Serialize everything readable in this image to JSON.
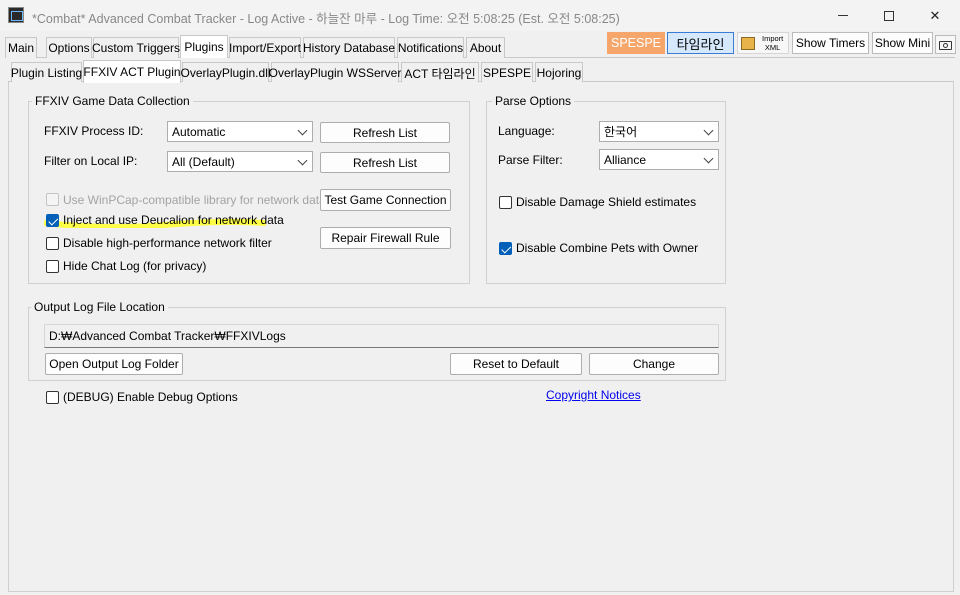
{
  "window": {
    "title": "*Combat* Advanced Combat Tracker - Log Active - 하늘잔 마루 - Log Time: 오전 5:08:25 (Est. 오전 5:08:25)",
    "minimize": "—",
    "maximize": "□",
    "close": "✕"
  },
  "main_tabs": [
    "Main",
    "Options",
    "Custom Triggers",
    "Plugins",
    "Import/Export",
    "History Database",
    "Notifications",
    "About"
  ],
  "toolbar": {
    "spespe_label": "SPESPE",
    "timeline_label": "타임라인",
    "import_xml_label": "Import XML",
    "import_xml_line1": "Import",
    "import_xml_line2": "XML",
    "show_timers_label": "Show Timers",
    "show_mini_label": "Show Mini",
    "camera_icon": "camera-icon"
  },
  "sub_tabs": [
    "Plugin Listing",
    "FFXIV ACT Plugin",
    "OverlayPlugin.dll",
    "OverlayPlugin WSServer",
    "ACT 타임라인",
    "SPESPE",
    "Hojoring"
  ],
  "game_data": {
    "title": "FFXIV Game Data Collection",
    "process_label": "FFXIV Process ID:",
    "process_value": "Automatic",
    "filter_label": "Filter on Local IP:",
    "filter_value": "All (Default)",
    "refresh_label": "Refresh List",
    "test_connection_label": "Test Game Connection",
    "repair_firewall_label": "Repair Firewall Rule",
    "checkboxes": [
      {
        "label": "Use WinPCap-compatible library for network data",
        "checked": false,
        "enabled": false
      },
      {
        "label": "Inject and use Deucalion for network data",
        "checked": true,
        "enabled": true
      },
      {
        "label": "Disable high-performance network filter",
        "checked": false,
        "enabled": true
      },
      {
        "label": "Hide Chat Log (for privacy)",
        "checked": false,
        "enabled": true
      }
    ],
    "highlight_color": "#ffff33"
  },
  "parse_options": {
    "title": "Parse Options",
    "language_label": "Language:",
    "language_value": "한국어",
    "filter_label": "Parse Filter:",
    "filter_value": "Alliance",
    "checkboxes": [
      {
        "label": "Disable Damage Shield estimates",
        "checked": false
      },
      {
        "label": "Disable Combine Pets with Owner",
        "checked": true
      }
    ]
  },
  "output_log": {
    "title": "Output Log File Location",
    "path": "D:₩Advanced Combat Tracker₩FFXIVLogs",
    "open_folder_label": "Open Output Log Folder",
    "reset_label": "Reset to Default",
    "change_label": "Change"
  },
  "debug": {
    "label": "(DEBUG) Enable Debug Options",
    "checked": false
  },
  "copyright_label": "Copyright Notices",
  "colors": {
    "accent": "#005fb8",
    "spespe": "#f6a66b",
    "timeline_bg": "#d6e8fb",
    "link": "#0000ee"
  }
}
